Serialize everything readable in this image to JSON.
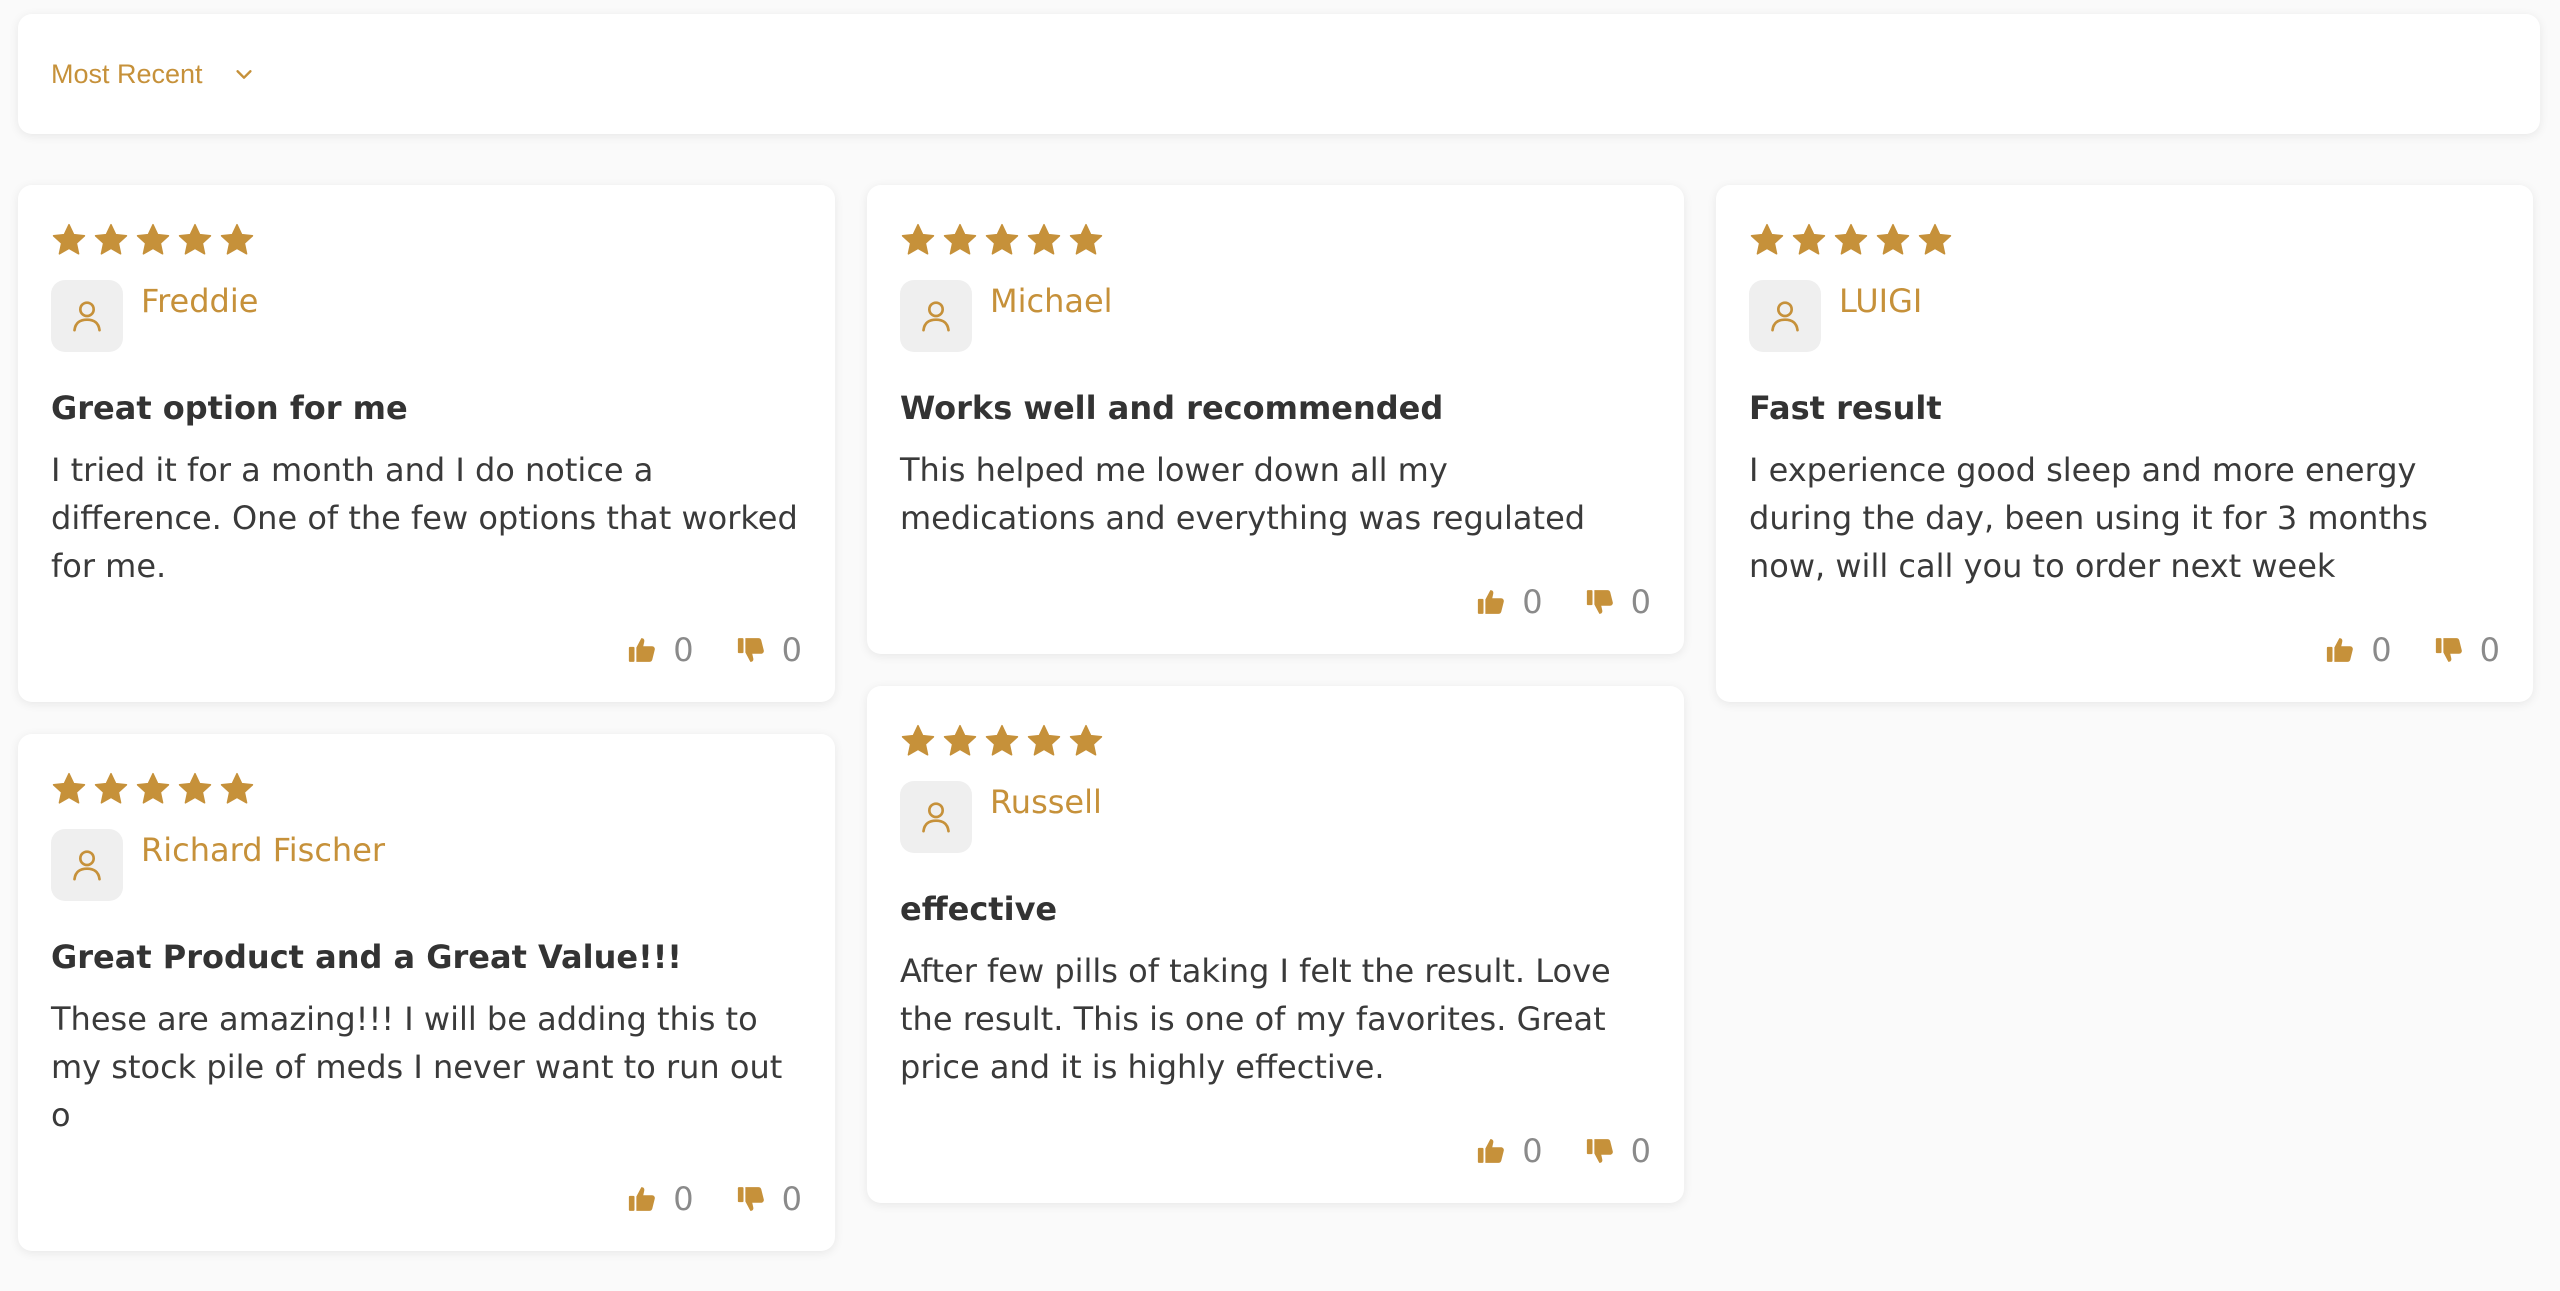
{
  "accent_color": "#c6913a",
  "sort": {
    "label": "Most Recent",
    "icon": "chevron-down-icon"
  },
  "columns": [
    [
      {
        "rating": 5,
        "author": "Freddie",
        "title": "Great option for me",
        "body": "I tried it for a month and I do notice a difference. One of the few options that worked for me.",
        "likes": "0",
        "dislikes": "0"
      },
      {
        "rating": 5,
        "author": "Richard Fischer",
        "title": "Great Product and a Great Value!!!",
        "body": "These are amazing!!! I will be adding this to my stock pile of meds I never want to run out o",
        "likes": "0",
        "dislikes": "0"
      }
    ],
    [
      {
        "rating": 5,
        "author": "Michael",
        "title": "Works well and recommended",
        "body": "This helped me lower down all my medications and everything was regulated",
        "likes": "0",
        "dislikes": "0"
      },
      {
        "rating": 5,
        "author": "Russell",
        "title": "effective",
        "body": "After few pills of taking I felt the result. Love the result. This is one of my favorites. Great price and it is highly effective.",
        "likes": "0",
        "dislikes": "0"
      }
    ],
    [
      {
        "rating": 5,
        "author": "LUIGI",
        "title": "Fast result",
        "body": "I experience good sleep and more energy during the day, been using it for 3 months now, will call you to order next week",
        "likes": "0",
        "dislikes": "0"
      }
    ]
  ]
}
